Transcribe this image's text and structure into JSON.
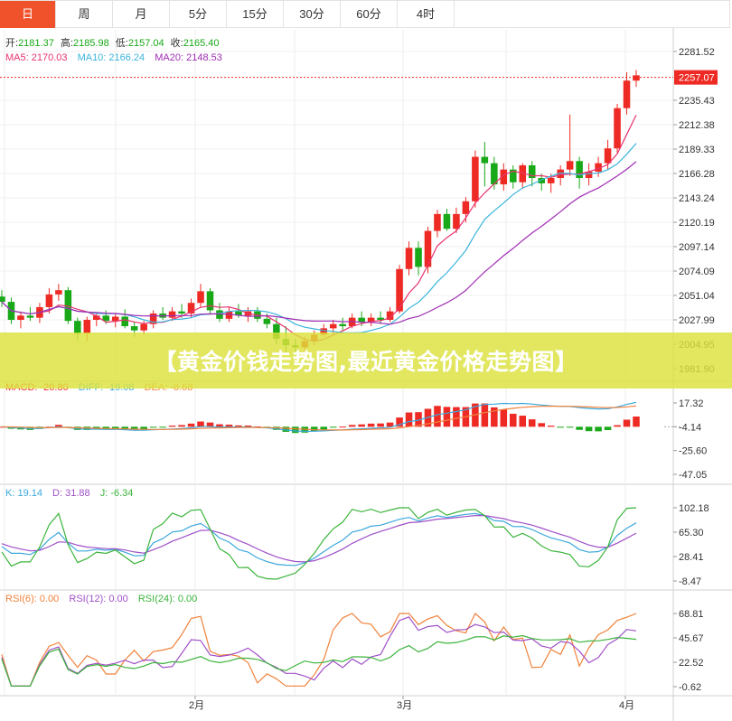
{
  "tabs": [
    "日",
    "周",
    "月",
    "5分",
    "15分",
    "30分",
    "60分",
    "4时"
  ],
  "active_tab": 0,
  "banner": "【黄金价钱走势图,最近黄金价格走势图】",
  "ohlc_info": {
    "open_label": "开:",
    "open": "2181.37",
    "high_label": "高:",
    "high": "2185.98",
    "low_label": "低:",
    "low": "2157.04",
    "close_label": "收:",
    "close": "2165.40"
  },
  "ma_info": {
    "ma5": "MA5: 2170.03",
    "ma10": "MA10: 2166.24",
    "ma20": "MA20: 2148.53"
  },
  "macd_info": {
    "macd": "MACD: -20.80",
    "diff": "DIFF: -19.08",
    "dea": "DEA: -8.68"
  },
  "kdj_info": {
    "k": "K: 19.14",
    "d": "D: 31.88",
    "j": "J: -6.34"
  },
  "rsi_info": {
    "rsi6": "RSI(6): 0.00",
    "rsi12": "RSI(12): 0.00",
    "rsi24": "RSI(24): 0.00"
  },
  "price_ticks": [
    "2281.52",
    "2235.43",
    "2212.38",
    "2189.33",
    "2166.28",
    "2143.24",
    "2120.19",
    "2097.14",
    "2074.09",
    "2051.04",
    "2027.99",
    "2004.95",
    "1981.90"
  ],
  "current_price": "2257.07",
  "macd_ticks": [
    "17.32",
    "-4.14",
    "-25.60",
    "-47.05"
  ],
  "kdj_ticks": [
    "102.18",
    "65.30",
    "28.41",
    "-8.47"
  ],
  "rsi_ticks": [
    "68.81",
    "45.67",
    "22.52",
    "-0.62"
  ],
  "x_labels": [
    "2月",
    "3月",
    "4月"
  ],
  "colors": {
    "up": "#ee2a24",
    "down": "#18a818",
    "ma5": "#e8326e",
    "ma10": "#3cb4dc",
    "ma20": "#a02cb4",
    "diff": "#3ca8dc",
    "dea": "#f0823c",
    "k": "#3ca8dc",
    "d": "#a050c8",
    "j": "#3cb43c",
    "rsi6": "#f0823c",
    "rsi12": "#a050c8",
    "rsi24": "#3cb43c",
    "tab_active": "#f0522c"
  },
  "chart_data": {
    "type": "candlestick",
    "price_range": [
      1981.9,
      2281.52
    ],
    "candles": [
      [
        2050,
        2056,
        2040,
        2045
      ],
      [
        2045,
        2049,
        2024,
        2028
      ],
      [
        2028,
        2036,
        2020,
        2032
      ],
      [
        2032,
        2040,
        2027,
        2030
      ],
      [
        2030,
        2044,
        2025,
        2040
      ],
      [
        2040,
        2058,
        2034,
        2052
      ],
      [
        2052,
        2062,
        2046,
        2056
      ],
      [
        2056,
        2059,
        2024,
        2027
      ],
      [
        2027,
        2030,
        2008,
        2015
      ],
      [
        2015,
        2031,
        2008,
        2028
      ],
      [
        2028,
        2035,
        2022,
        2032
      ],
      [
        2032,
        2037,
        2024,
        2027
      ],
      [
        2027,
        2034,
        2021,
        2031
      ],
      [
        2031,
        2038,
        2020,
        2022
      ],
      [
        2022,
        2026,
        2012,
        2018
      ],
      [
        2018,
        2027,
        2014,
        2024
      ],
      [
        2024,
        2037,
        2020,
        2034
      ],
      [
        2034,
        2040,
        2028,
        2030
      ],
      [
        2030,
        2040,
        2027,
        2036
      ],
      [
        2036,
        2043,
        2030,
        2034
      ],
      [
        2034,
        2048,
        2030,
        2044
      ],
      [
        2044,
        2062,
        2040,
        2055
      ],
      [
        2055,
        2058,
        2034,
        2037
      ],
      [
        2037,
        2044,
        2026,
        2029
      ],
      [
        2029,
        2040,
        2026,
        2036
      ],
      [
        2036,
        2043,
        2030,
        2032
      ],
      [
        2032,
        2040,
        2026,
        2036
      ],
      [
        2036,
        2040,
        2026,
        2029
      ],
      [
        2029,
        2034,
        2020,
        2024
      ],
      [
        2024,
        2030,
        2005,
        2010
      ],
      [
        2010,
        2022,
        1996,
        2004
      ],
      [
        2004,
        2010,
        1995,
        2002
      ],
      [
        2002,
        2012,
        1998,
        2008
      ],
      [
        2008,
        2018,
        2004,
        2014
      ],
      [
        2014,
        2024,
        2012,
        2020
      ],
      [
        2020,
        2028,
        2014,
        2024
      ],
      [
        2024,
        2030,
        2018,
        2022
      ],
      [
        2022,
        2034,
        2020,
        2030
      ],
      [
        2030,
        2036,
        2022,
        2026
      ],
      [
        2026,
        2034,
        2022,
        2030
      ],
      [
        2030,
        2036,
        2024,
        2028
      ],
      [
        2028,
        2040,
        2026,
        2036
      ],
      [
        2036,
        2080,
        2034,
        2076
      ],
      [
        2076,
        2102,
        2070,
        2096
      ],
      [
        2096,
        2102,
        2070,
        2078
      ],
      [
        2078,
        2116,
        2072,
        2112
      ],
      [
        2112,
        2132,
        2106,
        2128
      ],
      [
        2128,
        2133,
        2112,
        2114
      ],
      [
        2114,
        2134,
        2110,
        2128
      ],
      [
        2128,
        2144,
        2120,
        2140
      ],
      [
        2140,
        2188,
        2134,
        2182
      ],
      [
        2182,
        2196,
        2154,
        2176
      ],
      [
        2176,
        2182,
        2151,
        2156
      ],
      [
        2156,
        2176,
        2150,
        2170
      ],
      [
        2170,
        2174,
        2152,
        2158
      ],
      [
        2158,
        2176,
        2152,
        2174
      ],
      [
        2174,
        2178,
        2154,
        2162
      ],
      [
        2162,
        2166,
        2150,
        2157
      ],
      [
        2157,
        2166,
        2148,
        2162
      ],
      [
        2162,
        2174,
        2155,
        2170
      ],
      [
        2170,
        2222,
        2164,
        2178
      ],
      [
        2178,
        2182,
        2152,
        2162
      ],
      [
        2162,
        2176,
        2155,
        2168
      ],
      [
        2168,
        2182,
        2163,
        2176
      ],
      [
        2176,
        2198,
        2170,
        2190
      ],
      [
        2190,
        2232,
        2186,
        2228
      ],
      [
        2228,
        2262,
        2222,
        2254
      ],
      [
        2254,
        2264,
        2248,
        2259
      ]
    ],
    "macd_range": [
      -47.05,
      17.32
    ],
    "kdj_range": [
      -8.47,
      102.18
    ],
    "rsi_range": [
      -0.62,
      68.81
    ],
    "xlabel": "",
    "ylabel": ""
  }
}
